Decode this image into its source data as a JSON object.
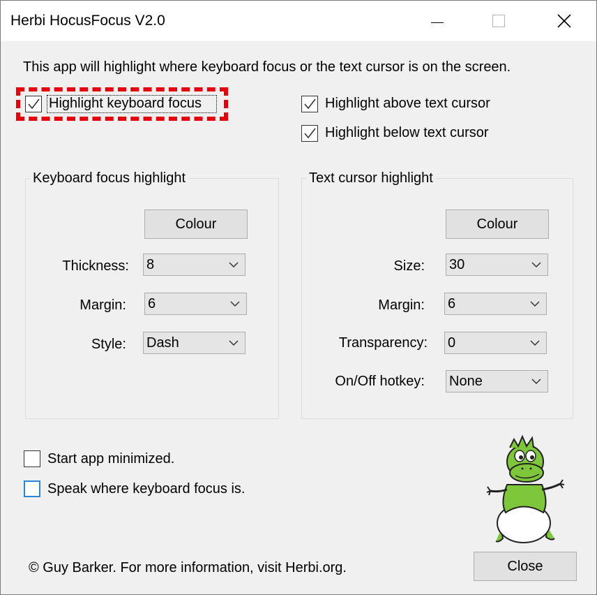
{
  "window": {
    "title": "Herbi HocusFocus V2.0"
  },
  "intro": "This app will highlight where keyboard focus or the text cursor is on the screen.",
  "checkboxes": {
    "highlight_keyboard_focus": {
      "label": "Highlight keyboard focus",
      "checked": true
    },
    "highlight_above_text_cursor": {
      "label": "Highlight above text cursor",
      "checked": true
    },
    "highlight_below_text_cursor": {
      "label": "Highlight below text cursor",
      "checked": true
    },
    "start_minimized": {
      "label": "Start app minimized.",
      "checked": false
    },
    "speak_focus": {
      "label": "Speak where keyboard focus is.",
      "checked": false
    }
  },
  "keyboard_group": {
    "legend": "Keyboard focus highlight",
    "colour_button": "Colour",
    "thickness_label": "Thickness:",
    "thickness_value": "8",
    "margin_label": "Margin:",
    "margin_value": "6",
    "style_label": "Style:",
    "style_value": "Dash"
  },
  "text_group": {
    "legend": "Text cursor highlight",
    "colour_button": "Colour",
    "size_label": "Size:",
    "size_value": "30",
    "margin_label": "Margin:",
    "margin_value": "6",
    "transparency_label": "Transparency:",
    "transparency_value": "0",
    "hotkey_label": "On/Off hotkey:",
    "hotkey_value": "None"
  },
  "footer": {
    "copyright": "© Guy Barker. For more information, visit Herbi.org.",
    "close_button": "Close"
  },
  "colors": {
    "focus_highlight": "#e8000b",
    "mascot_green": "#7ec63a",
    "checkbox_focus_blue": "#2b86d6"
  },
  "icons": [
    "minimize-icon",
    "maximize-icon",
    "close-icon",
    "checkmark-icon",
    "chevron-down-icon",
    "herbi-mascot"
  ]
}
